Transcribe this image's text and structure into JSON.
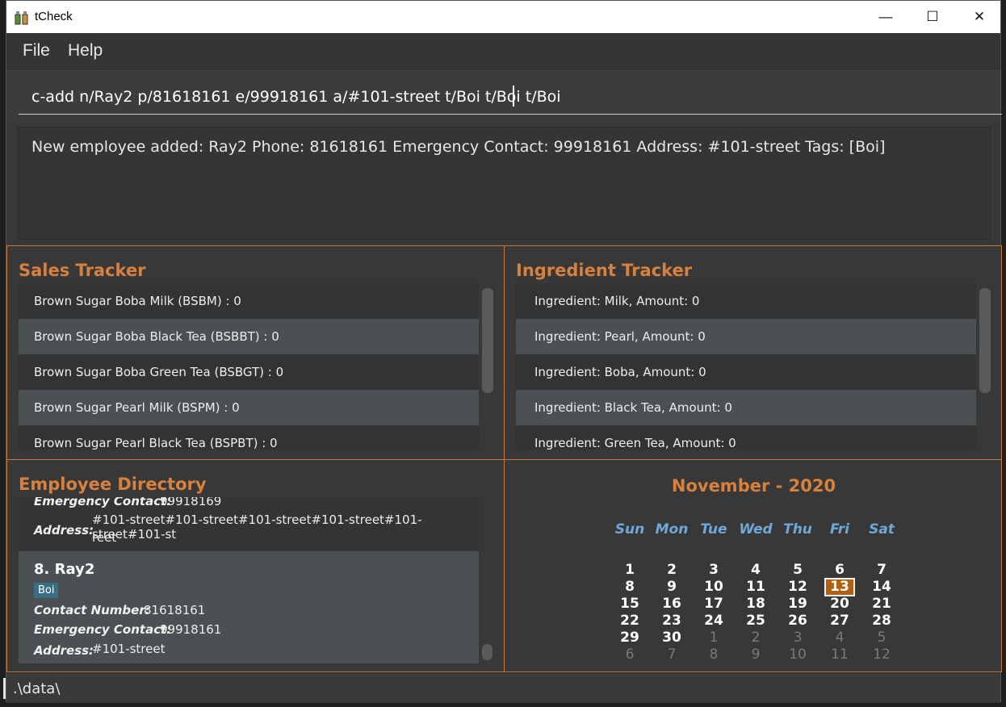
{
  "window": {
    "title": "tCheck",
    "controls": {
      "minimize": "—",
      "maximize": "☐",
      "close": "✕"
    }
  },
  "menu": {
    "file": "File",
    "help": "Help"
  },
  "command": {
    "value": "c-add n/Ray2 p/81618161 e/99918161 a/#101-street t/Boi t/Boi t/Boi"
  },
  "result": {
    "text": "New employee added: Ray2 Phone: 81618161 Emergency Contact: 99918161 Address: #101-street Tags: [Boi]"
  },
  "sales": {
    "title": "Sales Tracker",
    "items": [
      "Brown Sugar Boba Milk (BSBM) : 0",
      "Brown Sugar Boba Black Tea (BSBBT) : 0",
      "Brown Sugar Boba Green Tea (BSBGT) : 0",
      "Brown Sugar Pearl Milk (BSPM) : 0",
      "Brown Sugar Pearl Black Tea (BSPBT) : 0"
    ]
  },
  "ingredients": {
    "title": "Ingredient Tracker",
    "items": [
      "Ingredient: Milk,  Amount: 0",
      "Ingredient: Pearl,  Amount: 0",
      "Ingredient: Boba,  Amount: 0",
      "Ingredient: Black Tea,  Amount: 0",
      "Ingredient: Green Tea,  Amount: 0"
    ]
  },
  "employees": {
    "title": "Employee Directory",
    "previous": {
      "emergency_label": "Emergency Contact:",
      "emergency_value": "99918169",
      "address_label": "Address:",
      "address_line1": "#101-street#101-street#101-street#101-street#101-street#101-st",
      "address_line2": "reet"
    },
    "current": {
      "index_name": "8.   Ray2",
      "tag": "Boi",
      "contact_label": "Contact Number:",
      "contact_value": "81618161",
      "emergency_label": "Emergency Contact:",
      "emergency_value": "99918161",
      "address_label": "Address:",
      "address_value": "#101-street"
    }
  },
  "calendar": {
    "title": "November - 2020",
    "weekdays": [
      "Sun",
      "Mon",
      "Tue",
      "Wed",
      "Thu",
      "Fri",
      "Sat"
    ],
    "weeks": [
      [
        {
          "d": "1"
        },
        {
          "d": "2"
        },
        {
          "d": "3"
        },
        {
          "d": "4"
        },
        {
          "d": "5"
        },
        {
          "d": "6"
        },
        {
          "d": "7"
        }
      ],
      [
        {
          "d": "8"
        },
        {
          "d": "9"
        },
        {
          "d": "10"
        },
        {
          "d": "11"
        },
        {
          "d": "12"
        },
        {
          "d": "13",
          "today": true
        },
        {
          "d": "14"
        }
      ],
      [
        {
          "d": "15"
        },
        {
          "d": "16"
        },
        {
          "d": "17"
        },
        {
          "d": "18"
        },
        {
          "d": "19"
        },
        {
          "d": "20"
        },
        {
          "d": "21"
        }
      ],
      [
        {
          "d": "22"
        },
        {
          "d": "23"
        },
        {
          "d": "24"
        },
        {
          "d": "25"
        },
        {
          "d": "26"
        },
        {
          "d": "27"
        },
        {
          "d": "28"
        }
      ],
      [
        {
          "d": "29"
        },
        {
          "d": "30"
        },
        {
          "d": "1",
          "other": true
        },
        {
          "d": "2",
          "other": true
        },
        {
          "d": "3",
          "other": true
        },
        {
          "d": "4",
          "other": true
        },
        {
          "d": "5",
          "other": true
        }
      ],
      [
        {
          "d": "6",
          "other": true
        },
        {
          "d": "7",
          "other": true
        },
        {
          "d": "8",
          "other": true
        },
        {
          "d": "9",
          "other": true
        },
        {
          "d": "10",
          "other": true
        },
        {
          "d": "11",
          "other": true
        },
        {
          "d": "12",
          "other": true
        }
      ]
    ],
    "colors": {
      "accent": "#d8813f",
      "today_bg": "#b25f13",
      "weekday": "#6fa8d8"
    }
  },
  "status": {
    "path": ".\\data\\"
  }
}
